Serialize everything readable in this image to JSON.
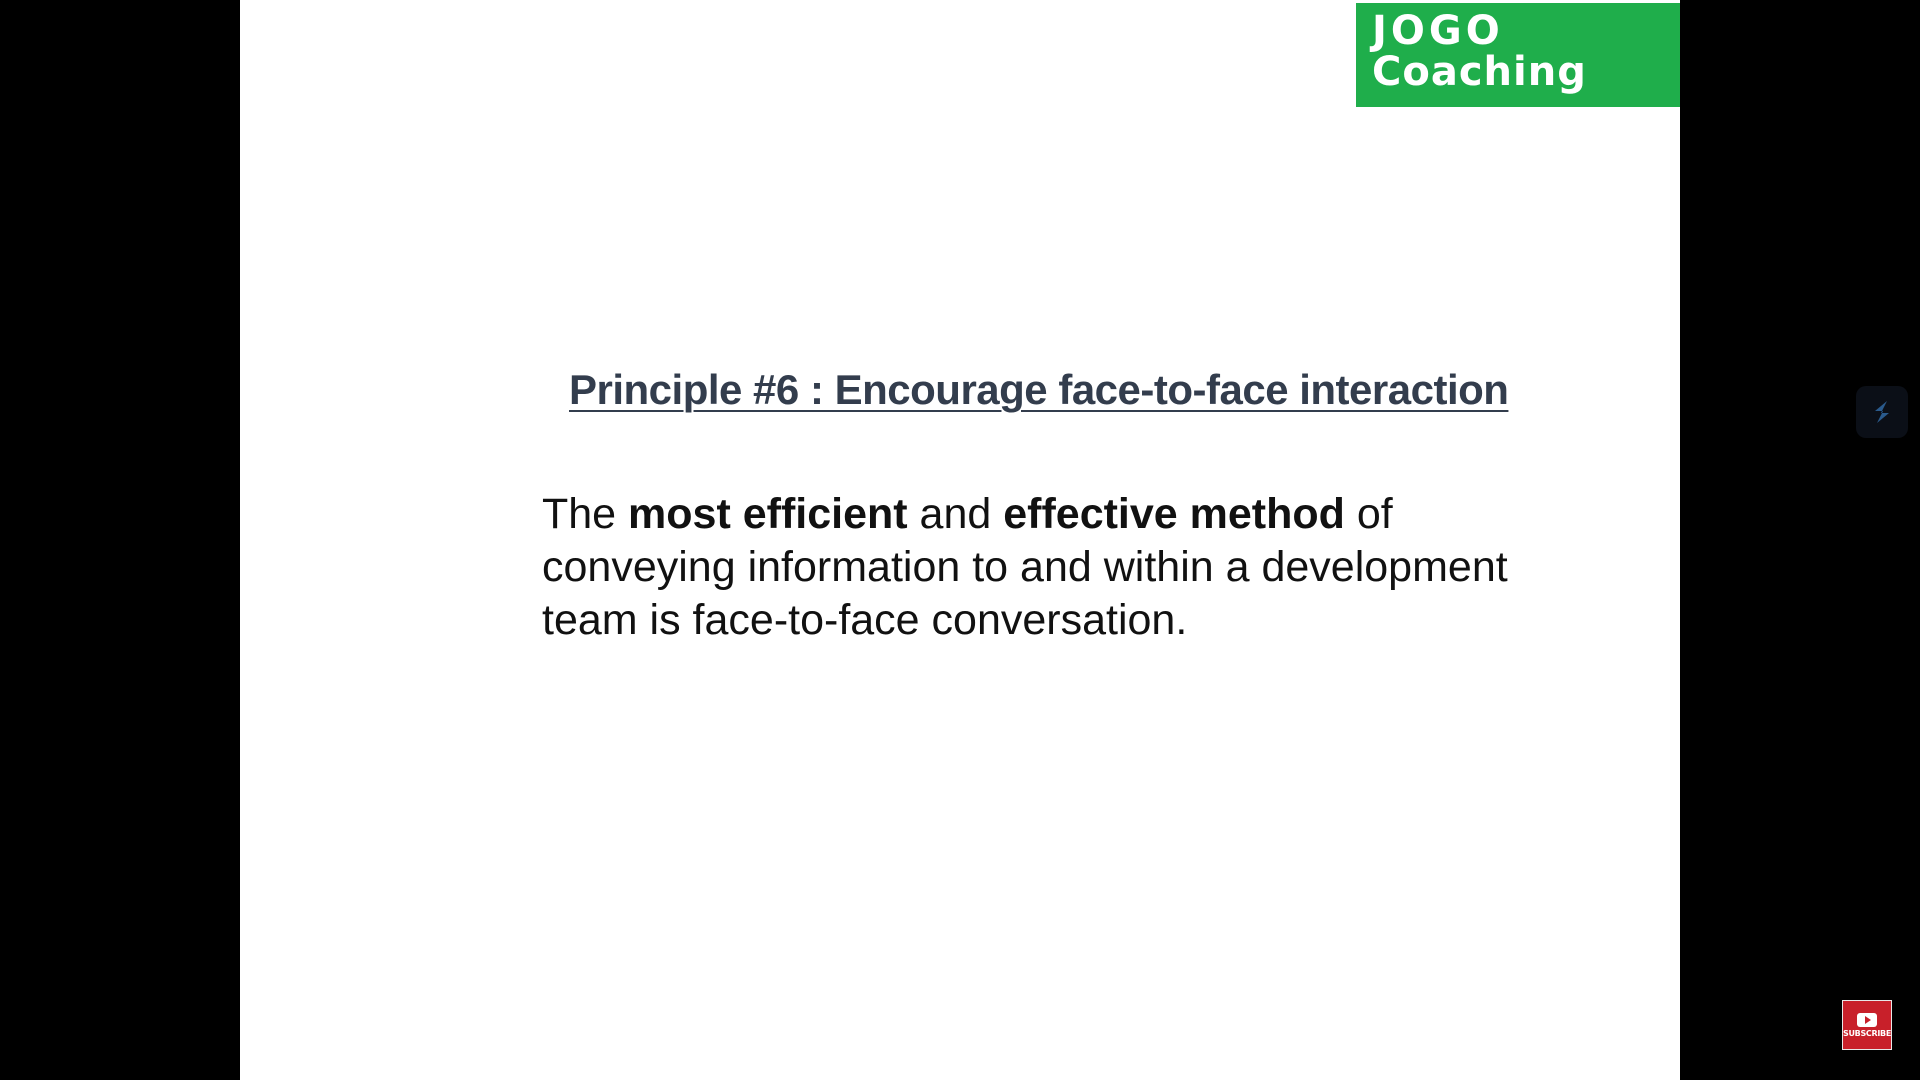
{
  "logo": {
    "line1": "JOGO",
    "line2": "Coaching",
    "color": "#1fae4b"
  },
  "slide": {
    "heading": "Principle #6 : Encourage face-to-face interaction",
    "body": {
      "part1": "The ",
      "bold1": "most efficient",
      "part2": " and ",
      "bold2": "effective method",
      "part3": " of conveying information to and within a development team is face-to-face conversation."
    }
  },
  "overlay": {
    "extension_icon": "slash-logo-icon",
    "subscribe_label": "SUBSCRIBE",
    "subscribe_icon": "youtube-play-icon"
  }
}
